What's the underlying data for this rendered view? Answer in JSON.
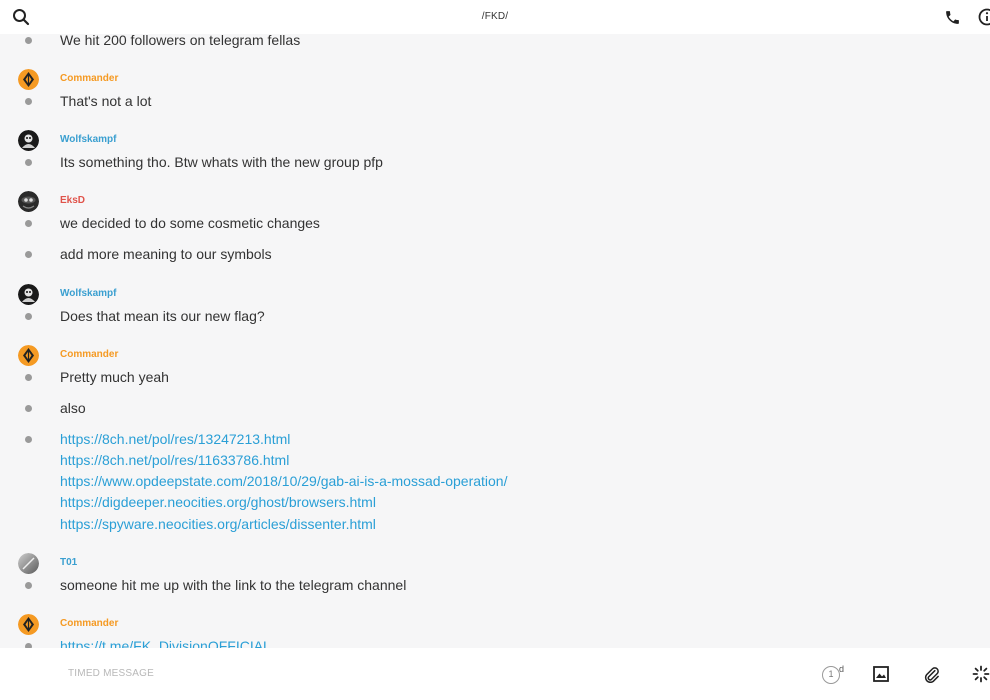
{
  "header": {
    "title": "/FKD/",
    "search_icon": "search-icon",
    "call_icon": "phone-icon",
    "info_icon": "info-icon"
  },
  "colors": {
    "commander": "#f59a23",
    "wolfskampf": "#3a9fd0",
    "eksd": "#e0534a",
    "t01": "#3a9fd0",
    "link": "#2a9fd6"
  },
  "messages": {
    "m0": {
      "text": "We hit 200 followers on telegram fellas"
    },
    "m1": {
      "sender": "Commander",
      "text": "That's not a lot"
    },
    "m2": {
      "sender": "Wolfskampf",
      "text": "Its something tho. Btw whats with the new group pfp"
    },
    "m3": {
      "sender": "EksD",
      "text": "we decided to do some cosmetic changes",
      "text2": "add more meaning to our symbols"
    },
    "m4": {
      "sender": "Wolfskampf",
      "text": "Does that mean its our new flag?"
    },
    "m5": {
      "sender": "Commander",
      "text": "Pretty much yeah",
      "text2": "also",
      "links": [
        "https://8ch.net/pol/res/13247213.html",
        "https://8ch.net/pol/res/11633786.html",
        "https://www.opdeepstate.com/2018/10/29/gab-ai-is-a-mossad-operation/",
        "https://digdeeper.neocities.org/ghost/browsers.html",
        "https://spyware.neocities.org/articles/dissenter.html"
      ]
    },
    "m6": {
      "sender": "T01",
      "text": "someone hit me up with the link to the telegram channel"
    },
    "m7": {
      "sender": "Commander",
      "text": "https://t.me/FK_DivisionOFFICIAL"
    }
  },
  "composer": {
    "placeholder": "TIMED MESSAGE",
    "timer_value": "1",
    "timer_unit": "d",
    "image_icon": "image-icon",
    "attach_icon": "paperclip-icon",
    "sticker_icon": "sparkle-icon"
  }
}
